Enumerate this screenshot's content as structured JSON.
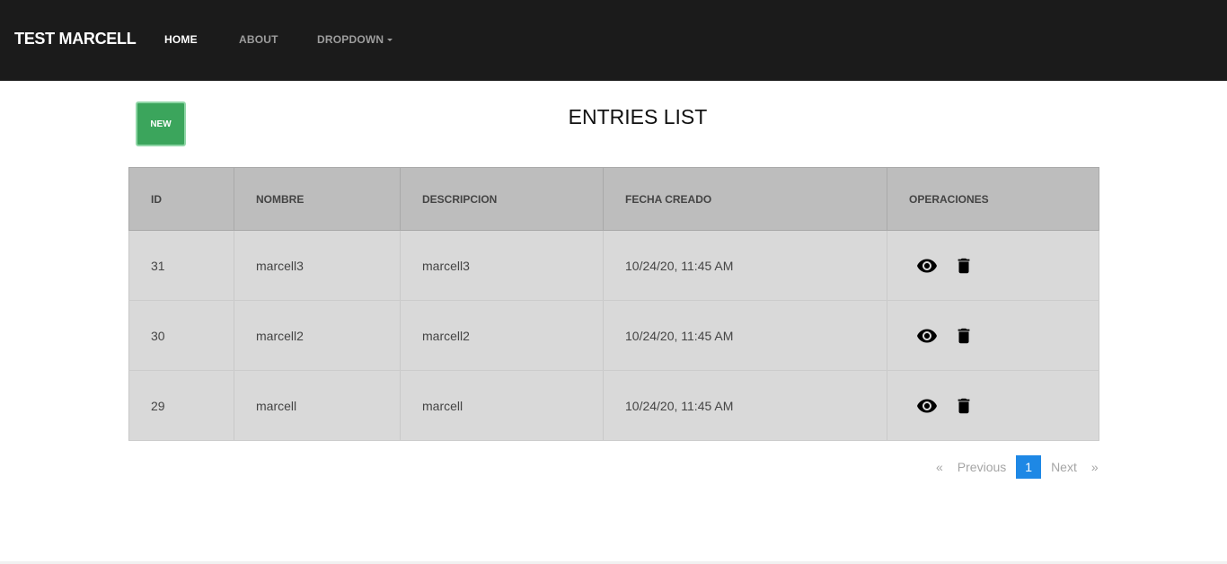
{
  "navbar": {
    "brand": "TEST MARCELL",
    "links": [
      {
        "label": "HOME",
        "active": true
      },
      {
        "label": "ABOUT",
        "active": false
      },
      {
        "label": "DROPDOWN",
        "active": false
      }
    ]
  },
  "actions": {
    "new_label": "NEW"
  },
  "page": {
    "title": "ENTRIES LIST"
  },
  "table": {
    "headers": [
      "ID",
      "NOMBRE",
      "DESCRIPCION",
      "FECHA CREADO",
      "OPERACIONES"
    ],
    "rows": [
      {
        "id": "31",
        "nombre": "marcell3",
        "descripcion": "marcell3",
        "fecha": "10/24/20, 11:45 AM",
        "icons": [
          "eye-icon",
          "trash-icon"
        ]
      },
      {
        "id": "30",
        "nombre": "marcell2",
        "descripcion": "marcell2",
        "fecha": "10/24/20, 11:45 AM",
        "icons": [
          "eye-icon",
          "trash-icon"
        ]
      },
      {
        "id": "29",
        "nombre": "marcell",
        "descripcion": "marcell",
        "fecha": "10/24/20, 11:45 AM",
        "icons": [
          "eye-icon",
          "trash-icon"
        ]
      }
    ]
  },
  "pagination": {
    "first": "«",
    "previous": "Previous",
    "current": "1",
    "next": "Next",
    "last": "»"
  },
  "colors": {
    "navbar_bg": "#1b1b1b",
    "new_button": "#3ba55c",
    "header_bg": "#bdbdbd",
    "row_bg": "#d9d9d9",
    "pagination_active": "#1e88e5"
  }
}
